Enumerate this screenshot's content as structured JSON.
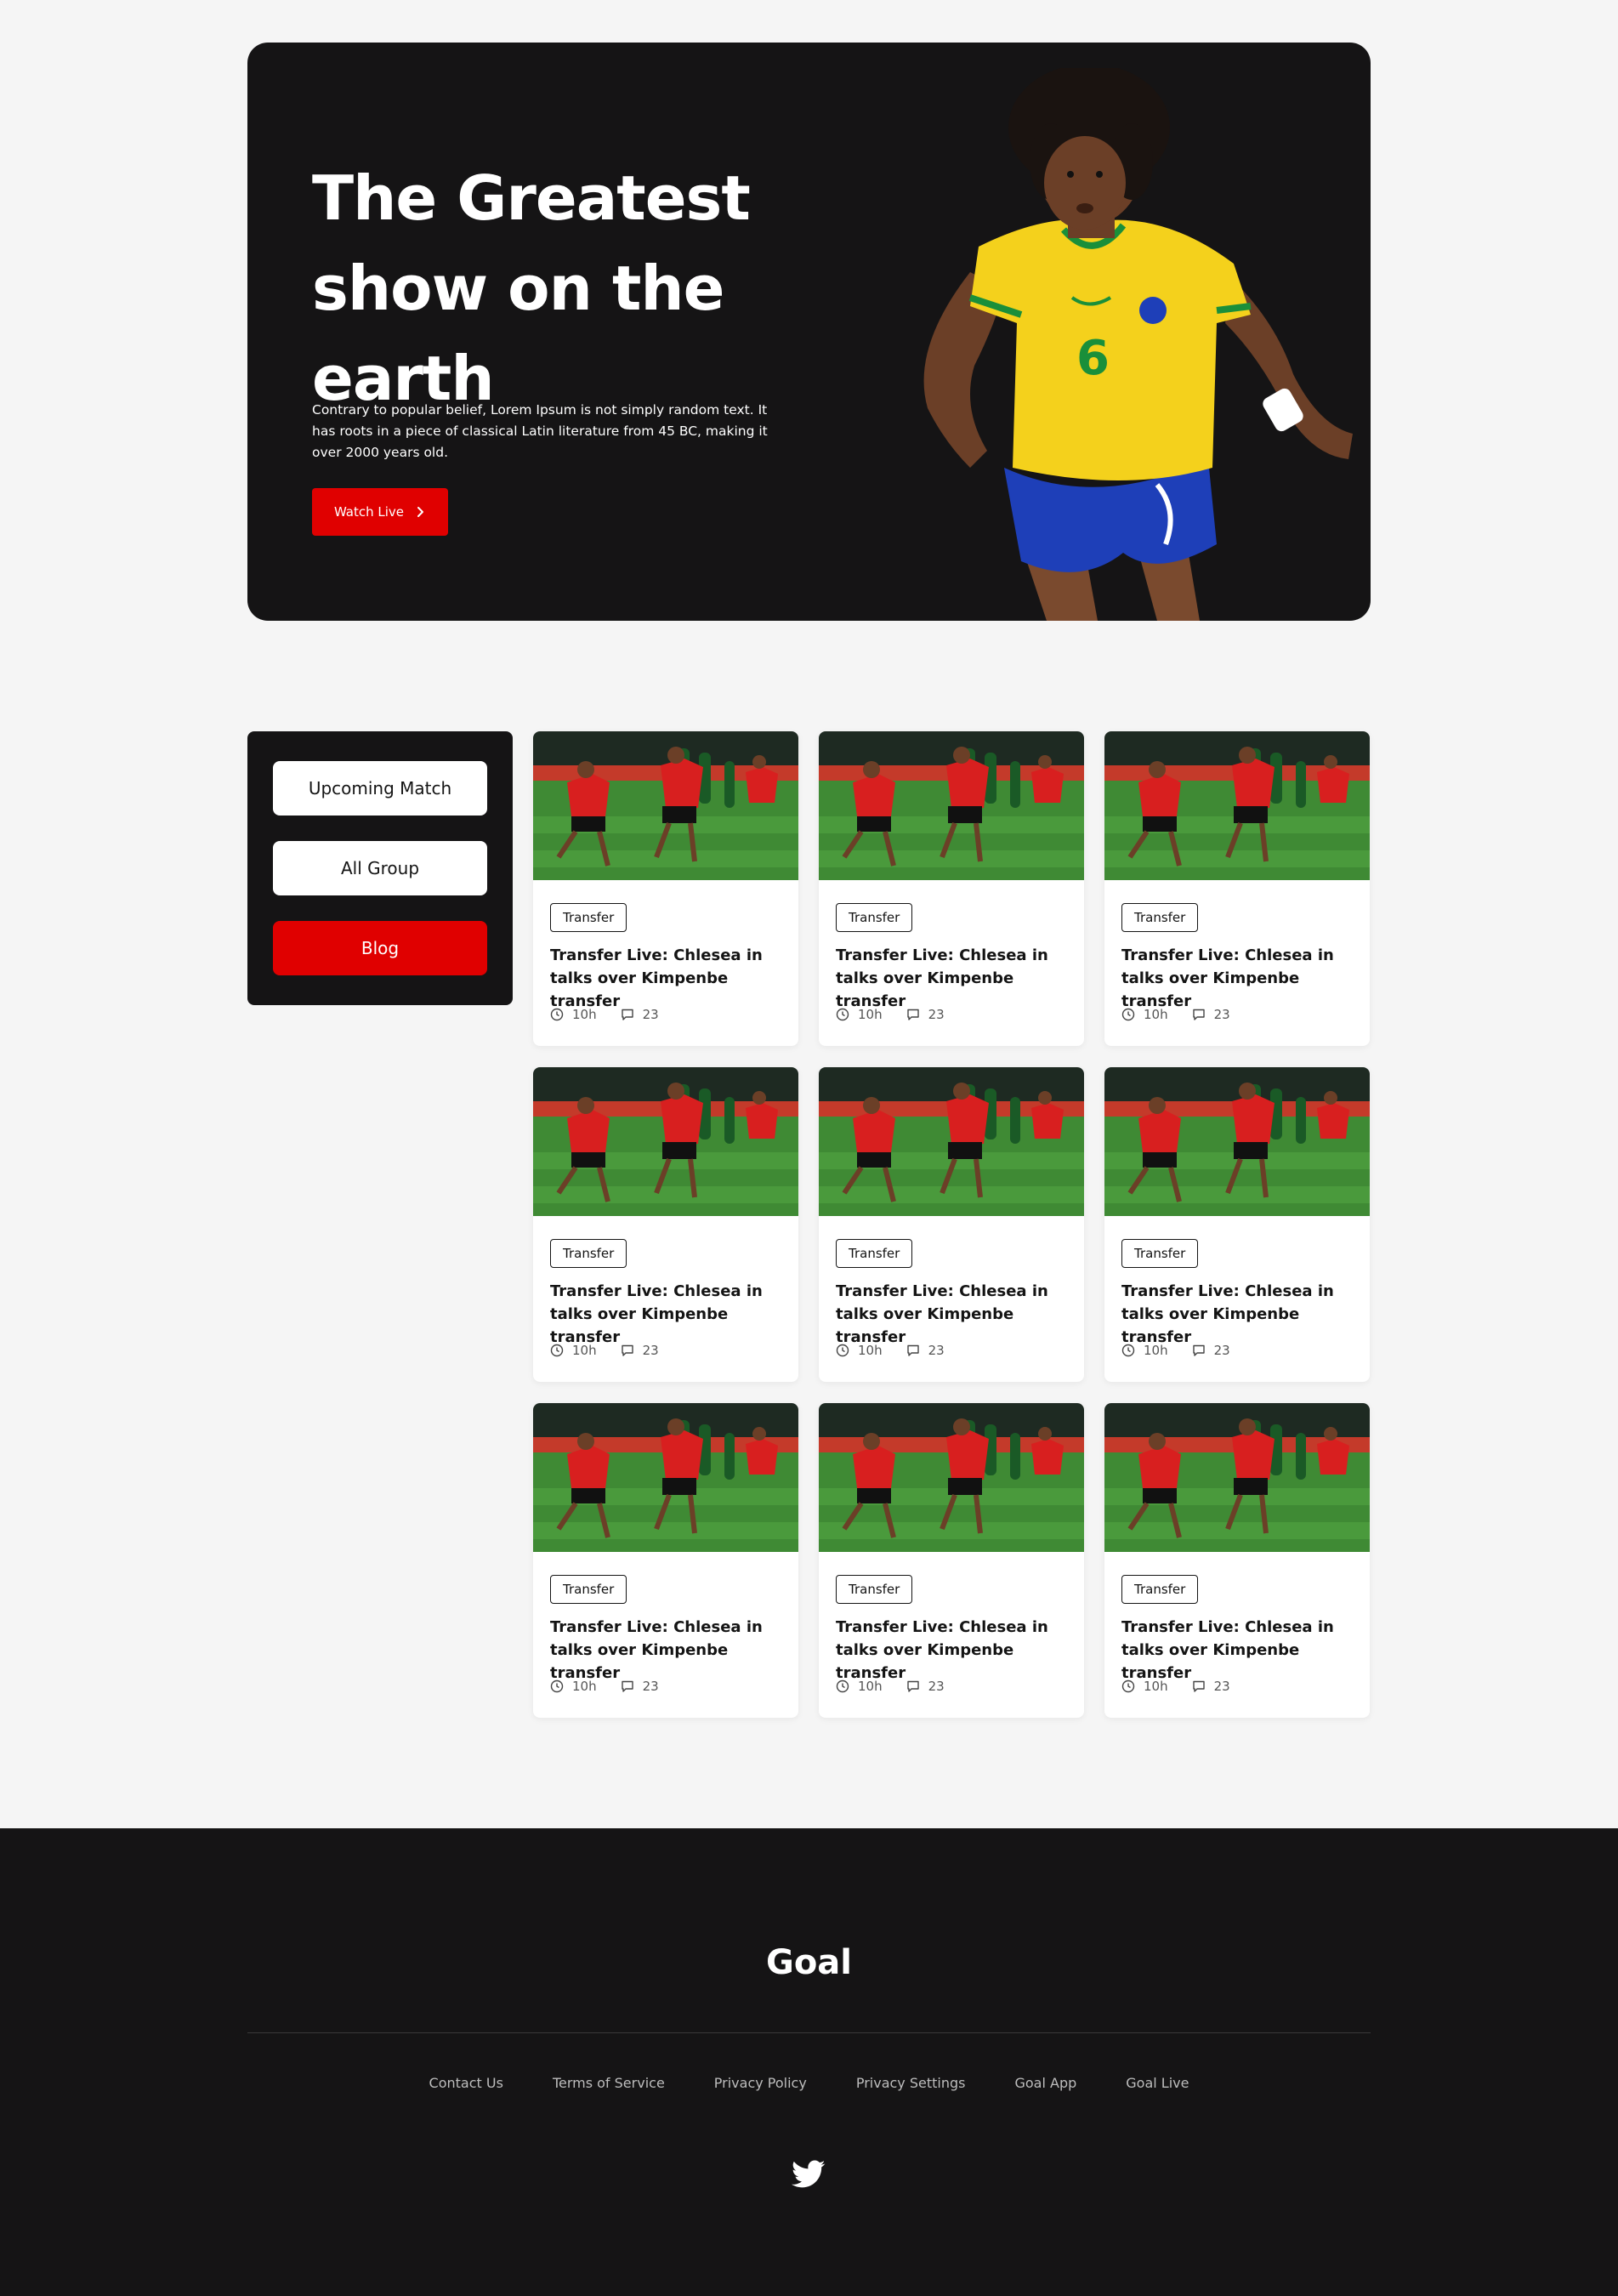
{
  "hero": {
    "title": "The Greatest show on the earth",
    "description": "Contrary to popular belief, Lorem Ipsum is not simply random text. It has roots in a piece of classical Latin literature from 45 BC, making it over 2000 years old.",
    "button_label": "Watch Live",
    "button_color": "#e00000"
  },
  "sidebar": {
    "items": [
      {
        "label": "Upcoming Match",
        "active": false
      },
      {
        "label": "All Group",
        "active": false
      },
      {
        "label": "Blog",
        "active": true
      }
    ]
  },
  "cards": [
    {
      "tag": "Transfer",
      "title": "Transfer Live: Chlesea in talks over Kimpenbe transfer",
      "time": "10h",
      "comments": "23"
    },
    {
      "tag": "Transfer",
      "title": "Transfer Live: Chlesea in talks over Kimpenbe transfer",
      "time": "10h",
      "comments": "23"
    },
    {
      "tag": "Transfer",
      "title": "Transfer Live: Chlesea in talks over Kimpenbe transfer",
      "time": "10h",
      "comments": "23"
    },
    {
      "tag": "Transfer",
      "title": "Transfer Live: Chlesea in talks over Kimpenbe transfer",
      "time": "10h",
      "comments": "23"
    },
    {
      "tag": "Transfer",
      "title": "Transfer Live: Chlesea in talks over Kimpenbe transfer",
      "time": "10h",
      "comments": "23"
    },
    {
      "tag": "Transfer",
      "title": "Transfer Live: Chlesea in talks over Kimpenbe transfer",
      "time": "10h",
      "comments": "23"
    },
    {
      "tag": "Transfer",
      "title": "Transfer Live: Chlesea in talks over Kimpenbe transfer",
      "time": "10h",
      "comments": "23"
    },
    {
      "tag": "Transfer",
      "title": "Transfer Live: Chlesea in talks over Kimpenbe transfer",
      "time": "10h",
      "comments": "23"
    },
    {
      "tag": "Transfer",
      "title": "Transfer Live: Chlesea in talks over Kimpenbe transfer",
      "time": "10h",
      "comments": "23"
    }
  ],
  "footer": {
    "logo": "Goal",
    "links": [
      "Contact Us",
      "Terms of Service",
      "Privacy Policy",
      "Privacy Settings",
      "Goal App",
      "Goal Live"
    ],
    "social_icon": "twitter-icon"
  },
  "colors": {
    "accent": "#e00000",
    "dark": "#151415",
    "background": "#f5f5f5"
  }
}
